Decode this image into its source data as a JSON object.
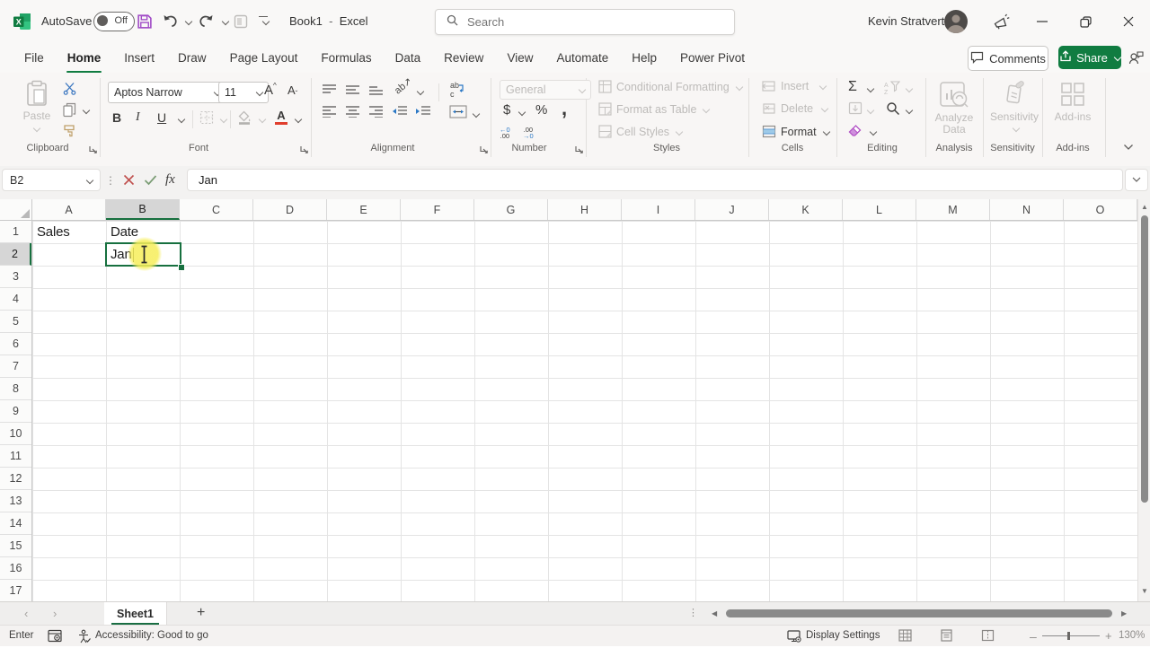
{
  "colors": {
    "accent_green": "#107c41",
    "selection_green": "#17703f",
    "save_purple": "#a04ac6",
    "font_color_red": "#e03e2d",
    "cursor_halo_yellow": "#f6ee5a"
  },
  "title_bar": {
    "autosave_label": "AutoSave",
    "autosave_state": "Off",
    "workbook_name": "Book1",
    "separator": "-",
    "app_name": "Excel",
    "search_placeholder": "Search",
    "user_name": "Kevin Stratvert"
  },
  "ribbon_tabs": [
    {
      "label": "File"
    },
    {
      "label": "Home",
      "active": true
    },
    {
      "label": "Insert"
    },
    {
      "label": "Draw"
    },
    {
      "label": "Page Layout"
    },
    {
      "label": "Formulas"
    },
    {
      "label": "Data"
    },
    {
      "label": "Review"
    },
    {
      "label": "View"
    },
    {
      "label": "Automate"
    },
    {
      "label": "Help"
    },
    {
      "label": "Power Pivot"
    }
  ],
  "ribbon_right": {
    "comments": "Comments",
    "share": "Share"
  },
  "ribbon": {
    "clipboard": {
      "group_label": "Clipboard",
      "paste": "Paste"
    },
    "font": {
      "group_label": "Font",
      "font_name": "Aptos Narrow",
      "font_size": "11",
      "bold": "B",
      "italic": "I",
      "underline": "U",
      "font_color_letter": "A"
    },
    "alignment": {
      "group_label": "Alignment"
    },
    "number": {
      "group_label": "Number",
      "format": "General",
      "currency": "$",
      "percent": "%",
      "comma": ",",
      "inc_decimal_top": "←0",
      "inc_decimal_bottom": ".00",
      "dec_decimal_top": ".00",
      "dec_decimal_bottom": "→0"
    },
    "styles": {
      "group_label": "Styles",
      "conditional": "Conditional Formatting",
      "format_table": "Format as Table",
      "cell_styles": "Cell Styles"
    },
    "cells": {
      "group_label": "Cells",
      "insert": "Insert",
      "delete": "Delete",
      "format": "Format"
    },
    "editing": {
      "group_label": "Editing",
      "autosum": "Σ"
    },
    "analysis": {
      "group_label": "Analysis",
      "button_line1": "Analyze",
      "button_line2": "Data"
    },
    "sensitivity": {
      "group_label": "Sensitivity",
      "button": "Sensitivity"
    },
    "addins": {
      "group_label": "Add-ins",
      "button": "Add-ins"
    }
  },
  "formula_bar": {
    "name_box": "B2",
    "fx_label": "fx",
    "content": "Jan"
  },
  "grid": {
    "columns": [
      {
        "label": "A"
      },
      {
        "label": "B",
        "active": true
      },
      {
        "label": "C"
      },
      {
        "label": "D"
      },
      {
        "label": "E"
      },
      {
        "label": "F"
      },
      {
        "label": "G"
      },
      {
        "label": "H"
      },
      {
        "label": "I"
      },
      {
        "label": "J"
      },
      {
        "label": "K"
      },
      {
        "label": "L"
      },
      {
        "label": "M"
      },
      {
        "label": "N"
      },
      {
        "label": "O"
      }
    ],
    "rows": [
      {
        "label": "1"
      },
      {
        "label": "2",
        "active": true
      },
      {
        "label": "3"
      },
      {
        "label": "4"
      },
      {
        "label": "5"
      },
      {
        "label": "6"
      },
      {
        "label": "7"
      },
      {
        "label": "8"
      },
      {
        "label": "9"
      },
      {
        "label": "10"
      },
      {
        "label": "11"
      },
      {
        "label": "12"
      },
      {
        "label": "13"
      },
      {
        "label": "14"
      },
      {
        "label": "15"
      },
      {
        "label": "16"
      },
      {
        "label": "17"
      }
    ],
    "cells": {
      "A1": "Sales",
      "B1": "Date"
    },
    "edit_cell": {
      "ref": "B2",
      "value": "Jan"
    }
  },
  "sheet_bar": {
    "tabs": [
      {
        "label": "Sheet1",
        "active": true
      }
    ],
    "add_label": "+"
  },
  "status_bar": {
    "mode": "Enter",
    "accessibility": "Accessibility: Good to go",
    "display_settings": "Display Settings",
    "zoom_level": "130%"
  }
}
